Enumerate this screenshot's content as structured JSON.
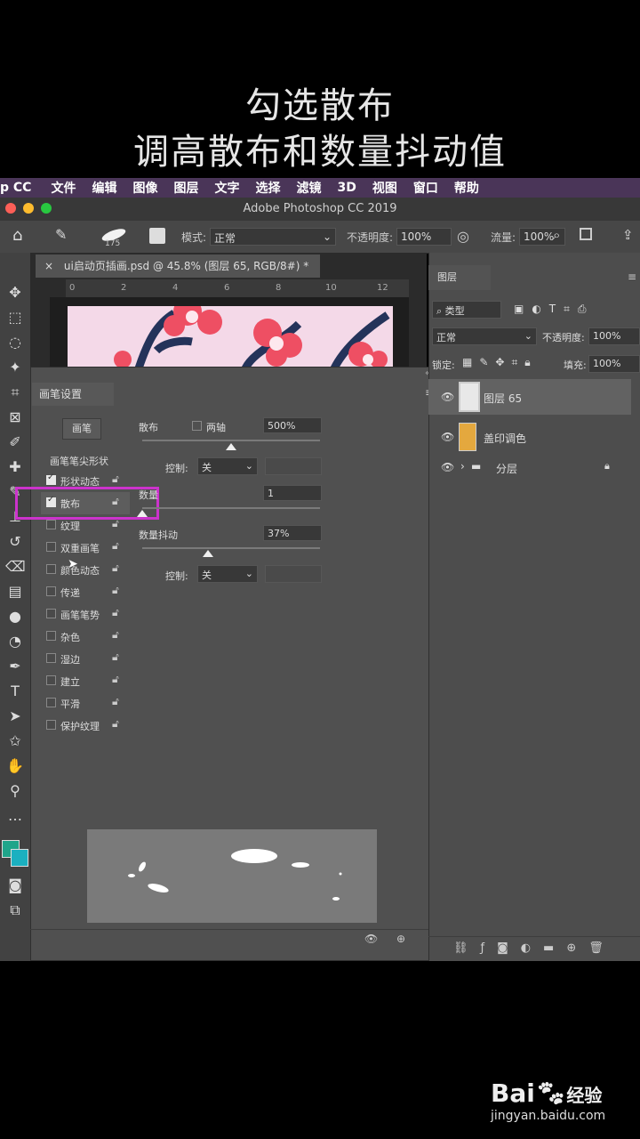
{
  "caption": {
    "line1": "勾选散布",
    "line2": "调高散布和数量抖动值"
  },
  "menubar": {
    "app": "p CC",
    "items": [
      "文件",
      "编辑",
      "图像",
      "图层",
      "文字",
      "选择",
      "滤镜",
      "3D",
      "视图",
      "窗口",
      "帮助"
    ]
  },
  "window": {
    "title": "Adobe Photoshop CC 2019"
  },
  "options": {
    "brush_size": "175",
    "mode_label": "模式:",
    "mode_value": "正常",
    "opacity_label": "不透明度:",
    "opacity_value": "100%",
    "flow_label": "流量:",
    "flow_value": "100%"
  },
  "document": {
    "tab": "ui启动页插画.psd @ 45.8% (图层 65, RGB/8#) *",
    "ruler": [
      "0",
      "2",
      "4",
      "6",
      "8",
      "10",
      "12"
    ]
  },
  "brush_panel": {
    "tab": "画笔设置",
    "brush_button": "画笔",
    "tip_shape": "画笔笔尖形状",
    "items": [
      {
        "label": "形状动态",
        "checked": true
      },
      {
        "label": "散布",
        "checked": true
      },
      {
        "label": "纹理",
        "checked": false
      },
      {
        "label": "双重画笔",
        "checked": false
      },
      {
        "label": "颜色动态",
        "checked": false
      },
      {
        "label": "传递",
        "checked": false
      },
      {
        "label": "画笔笔势",
        "checked": false
      },
      {
        "label": "杂色",
        "checked": false
      },
      {
        "label": "湿边",
        "checked": false
      },
      {
        "label": "建立",
        "checked": false
      },
      {
        "label": "平滑",
        "checked": false
      },
      {
        "label": "保护纹理",
        "checked": false
      }
    ],
    "scatter_label": "散布",
    "both_axes_label": "两轴",
    "scatter_value": "500%",
    "scatter_level": 0.5,
    "control_label": "控制:",
    "control_value": "关",
    "count_label": "数量",
    "count_value": "1",
    "count_level": 0.0,
    "count_jitter_label": "数量抖动",
    "count_jitter_value": "37%",
    "count_jitter_level": 0.37,
    "control2_label": "控制:",
    "control2_value": "关"
  },
  "layers_panel": {
    "tab": "图层",
    "filter_label": "类型",
    "blend_mode": "正常",
    "opacity_label": "不透明度:",
    "opacity_value": "100%",
    "lock_label": "锁定:",
    "fill_label": "填充:",
    "fill_value": "100%",
    "layers": [
      {
        "name": "图层 65"
      },
      {
        "name": "盖印调色"
      },
      {
        "name": "分层"
      }
    ]
  },
  "watermark": {
    "brand": "Bai",
    "brand2": "经验",
    "url": "jingyan.baidu.com"
  },
  "colors": {
    "highlight": "#cc33cc",
    "foreground": "#1fa58a",
    "background": "#1bb0c0",
    "menubar": "#4a3558"
  }
}
